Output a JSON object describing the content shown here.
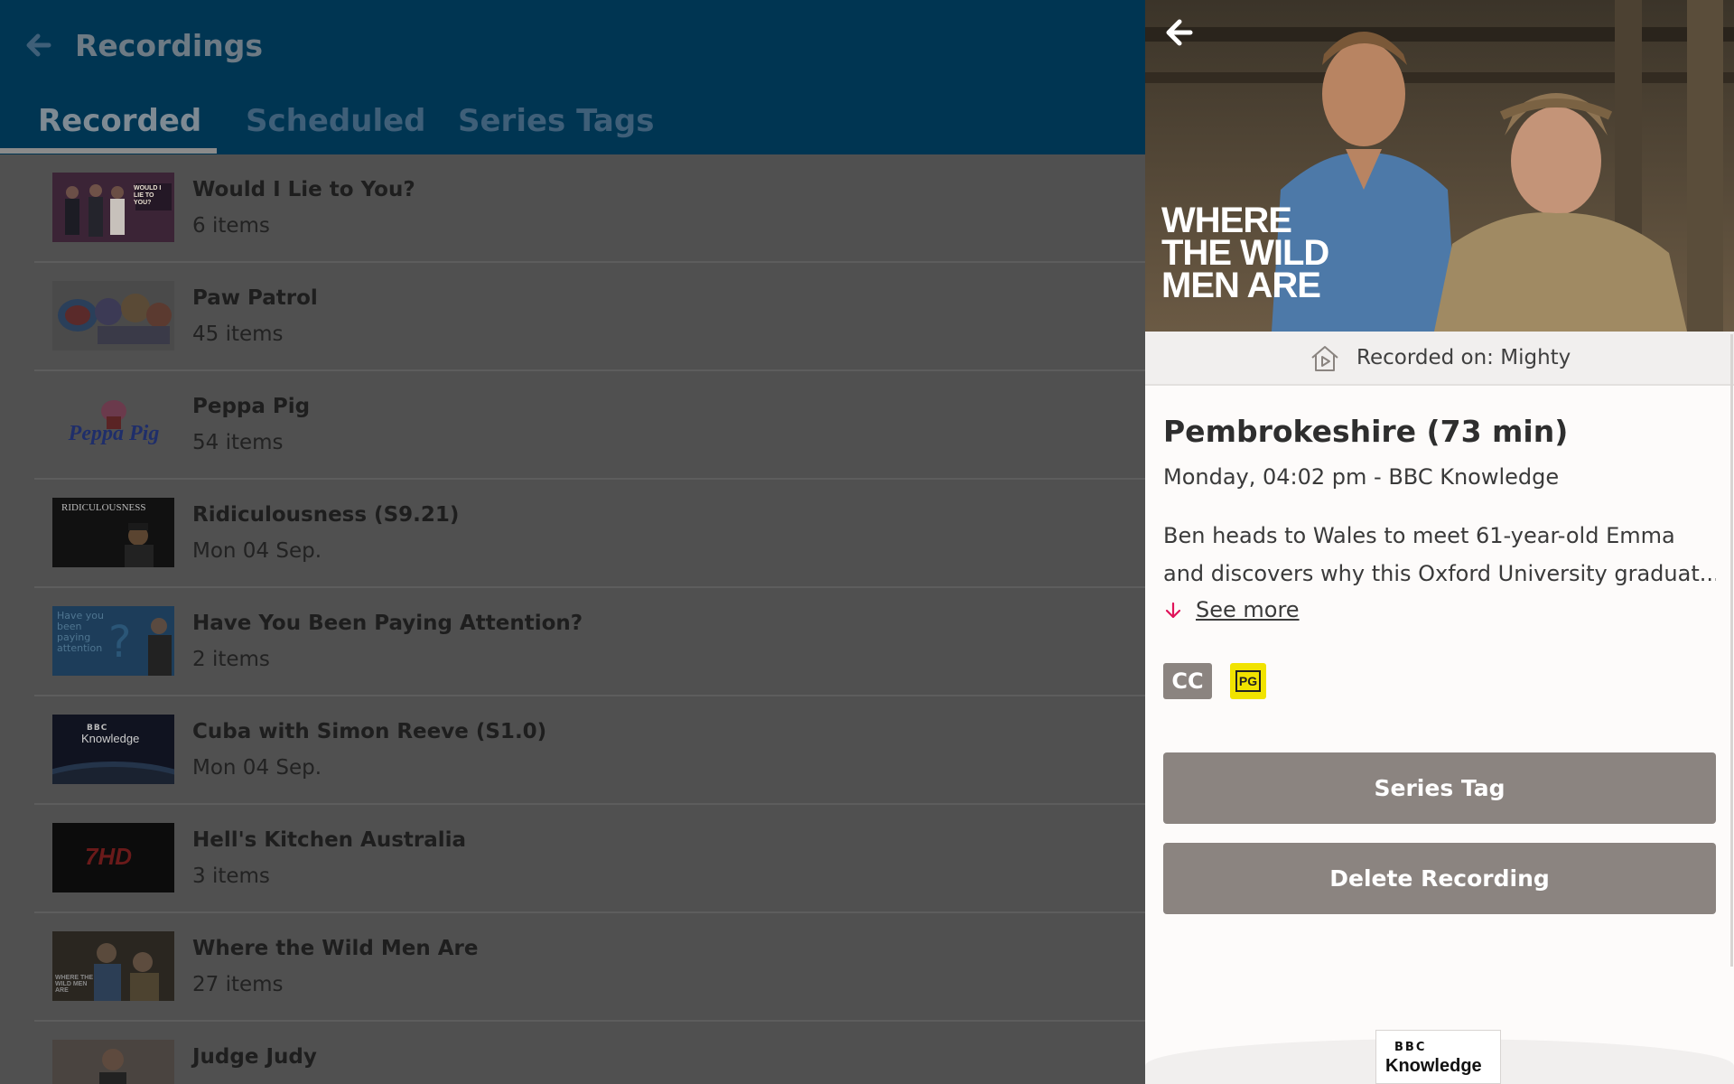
{
  "header": {
    "title": "Recordings",
    "tabs": [
      {
        "label": "Recorded",
        "active": true
      },
      {
        "label": "Scheduled",
        "active": false
      },
      {
        "label": "Series Tags",
        "active": false
      }
    ]
  },
  "recordings": [
    {
      "title": "Would I Lie to You?",
      "subtitle": "6 items"
    },
    {
      "title": "Paw Patrol",
      "subtitle": "45 items"
    },
    {
      "title": "Peppa Pig",
      "subtitle": "54 items"
    },
    {
      "title": "Ridiculousness (S9.21)",
      "subtitle": "Mon 04 Sep."
    },
    {
      "title": "Have You Been Paying Attention?",
      "subtitle": "2 items"
    },
    {
      "title": "Cuba with Simon Reeve (S1.0)",
      "subtitle": "Mon 04 Sep."
    },
    {
      "title": "Hell's Kitchen Australia",
      "subtitle": "3 items"
    },
    {
      "title": "Where the Wild Men Are",
      "subtitle": "27 items"
    },
    {
      "title": "Judge Judy",
      "subtitle": ""
    }
  ],
  "thumb_text": {
    "wilty": "WOULD I LIE TO YOU?",
    "peppa": "Peppa Pig",
    "ridic": "RIDICULOUSNESS",
    "hybpa": "Have you been paying attention",
    "bbc_mark": "BBC",
    "bbc_word": "Knowledge",
    "sevenhd": "7HD",
    "wild": "WHERE THE WILD MEN ARE"
  },
  "detail": {
    "hero_title_lines": [
      "WHERE",
      "THE WILD",
      "MEN ARE"
    ],
    "recorded_on": "Recorded on: Mighty",
    "episode_title": "Pembrokeshire (73 min)",
    "meta": "Monday, 04:02 pm - BBC Knowledge",
    "description_lines": [
      "Ben heads to Wales to meet 61-year-old Emma",
      "and discovers why this Oxford University graduat..."
    ],
    "see_more": "See more",
    "badges": {
      "cc": "CC",
      "rating": "PG"
    },
    "buttons": {
      "series_tag": "Series Tag",
      "delete": "Delete Recording"
    },
    "channel_logo": {
      "mark": "BBC",
      "word": "Knowledge"
    }
  },
  "colors": {
    "header_bg": "#003552",
    "accent_pink": "#e0145a",
    "button_bg": "#8b8480",
    "rating_yellow": "#f1e300"
  }
}
